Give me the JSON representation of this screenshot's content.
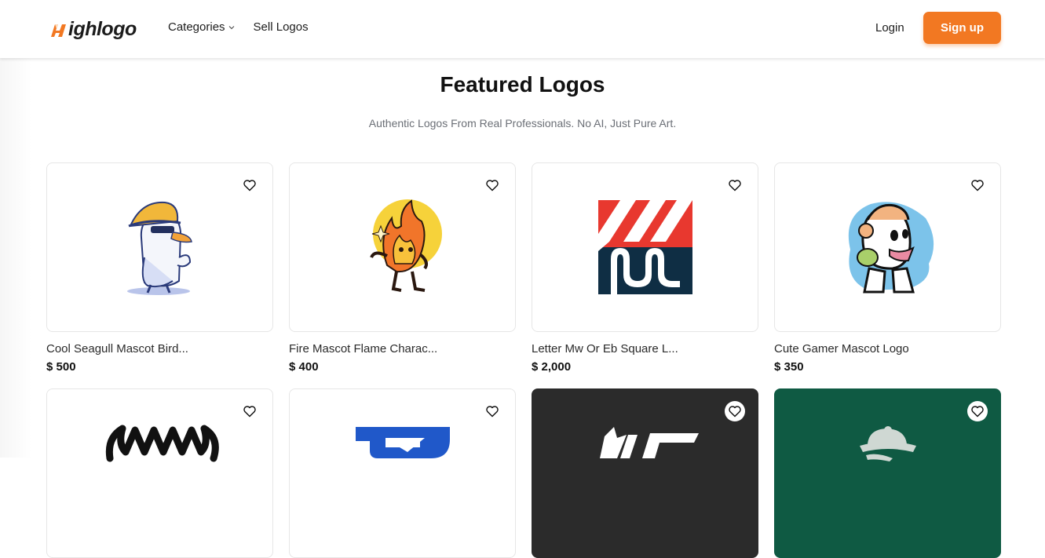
{
  "header": {
    "brand": "ighlogo",
    "nav": [
      {
        "label": "Categories",
        "has_dropdown": true
      },
      {
        "label": "Sell Logos",
        "has_dropdown": false
      }
    ],
    "login_label": "Login",
    "signup_label": "Sign up",
    "accent": "#f27822"
  },
  "section": {
    "title": "Featured Logos",
    "subtitle": "Authentic Logos From Real Professionals. No AI, Just Pure Art."
  },
  "cards": [
    {
      "name": "Cool Seagull Mascot Bird...",
      "price": "$ 500",
      "art": "seagull-mascot",
      "favorite_icon": "heart-icon"
    },
    {
      "name": "Fire Mascot Flame Charac...",
      "price": "$ 400",
      "art": "fire-mascot",
      "favorite_icon": "heart-icon"
    },
    {
      "name": "Letter Mw Or Eb Square L...",
      "price": "$ 2,000",
      "art": "letter-mw-square",
      "favorite_icon": "heart-icon"
    },
    {
      "name": "Cute Gamer Mascot Logo",
      "price": "$ 350",
      "art": "gamer-mascot",
      "favorite_icon": "heart-icon"
    },
    {
      "name": "",
      "price": "",
      "art": "horned-wordmark",
      "favorite_icon": "heart-icon"
    },
    {
      "name": "",
      "price": "",
      "art": "blue-letter-mark",
      "favorite_icon": "heart-icon"
    },
    {
      "name": "",
      "price": "",
      "art": "dark-letter-mark",
      "favorite_icon": "heart-icon"
    },
    {
      "name": "",
      "price": "",
      "art": "green-hat-mascot",
      "favorite_icon": "heart-icon"
    }
  ]
}
